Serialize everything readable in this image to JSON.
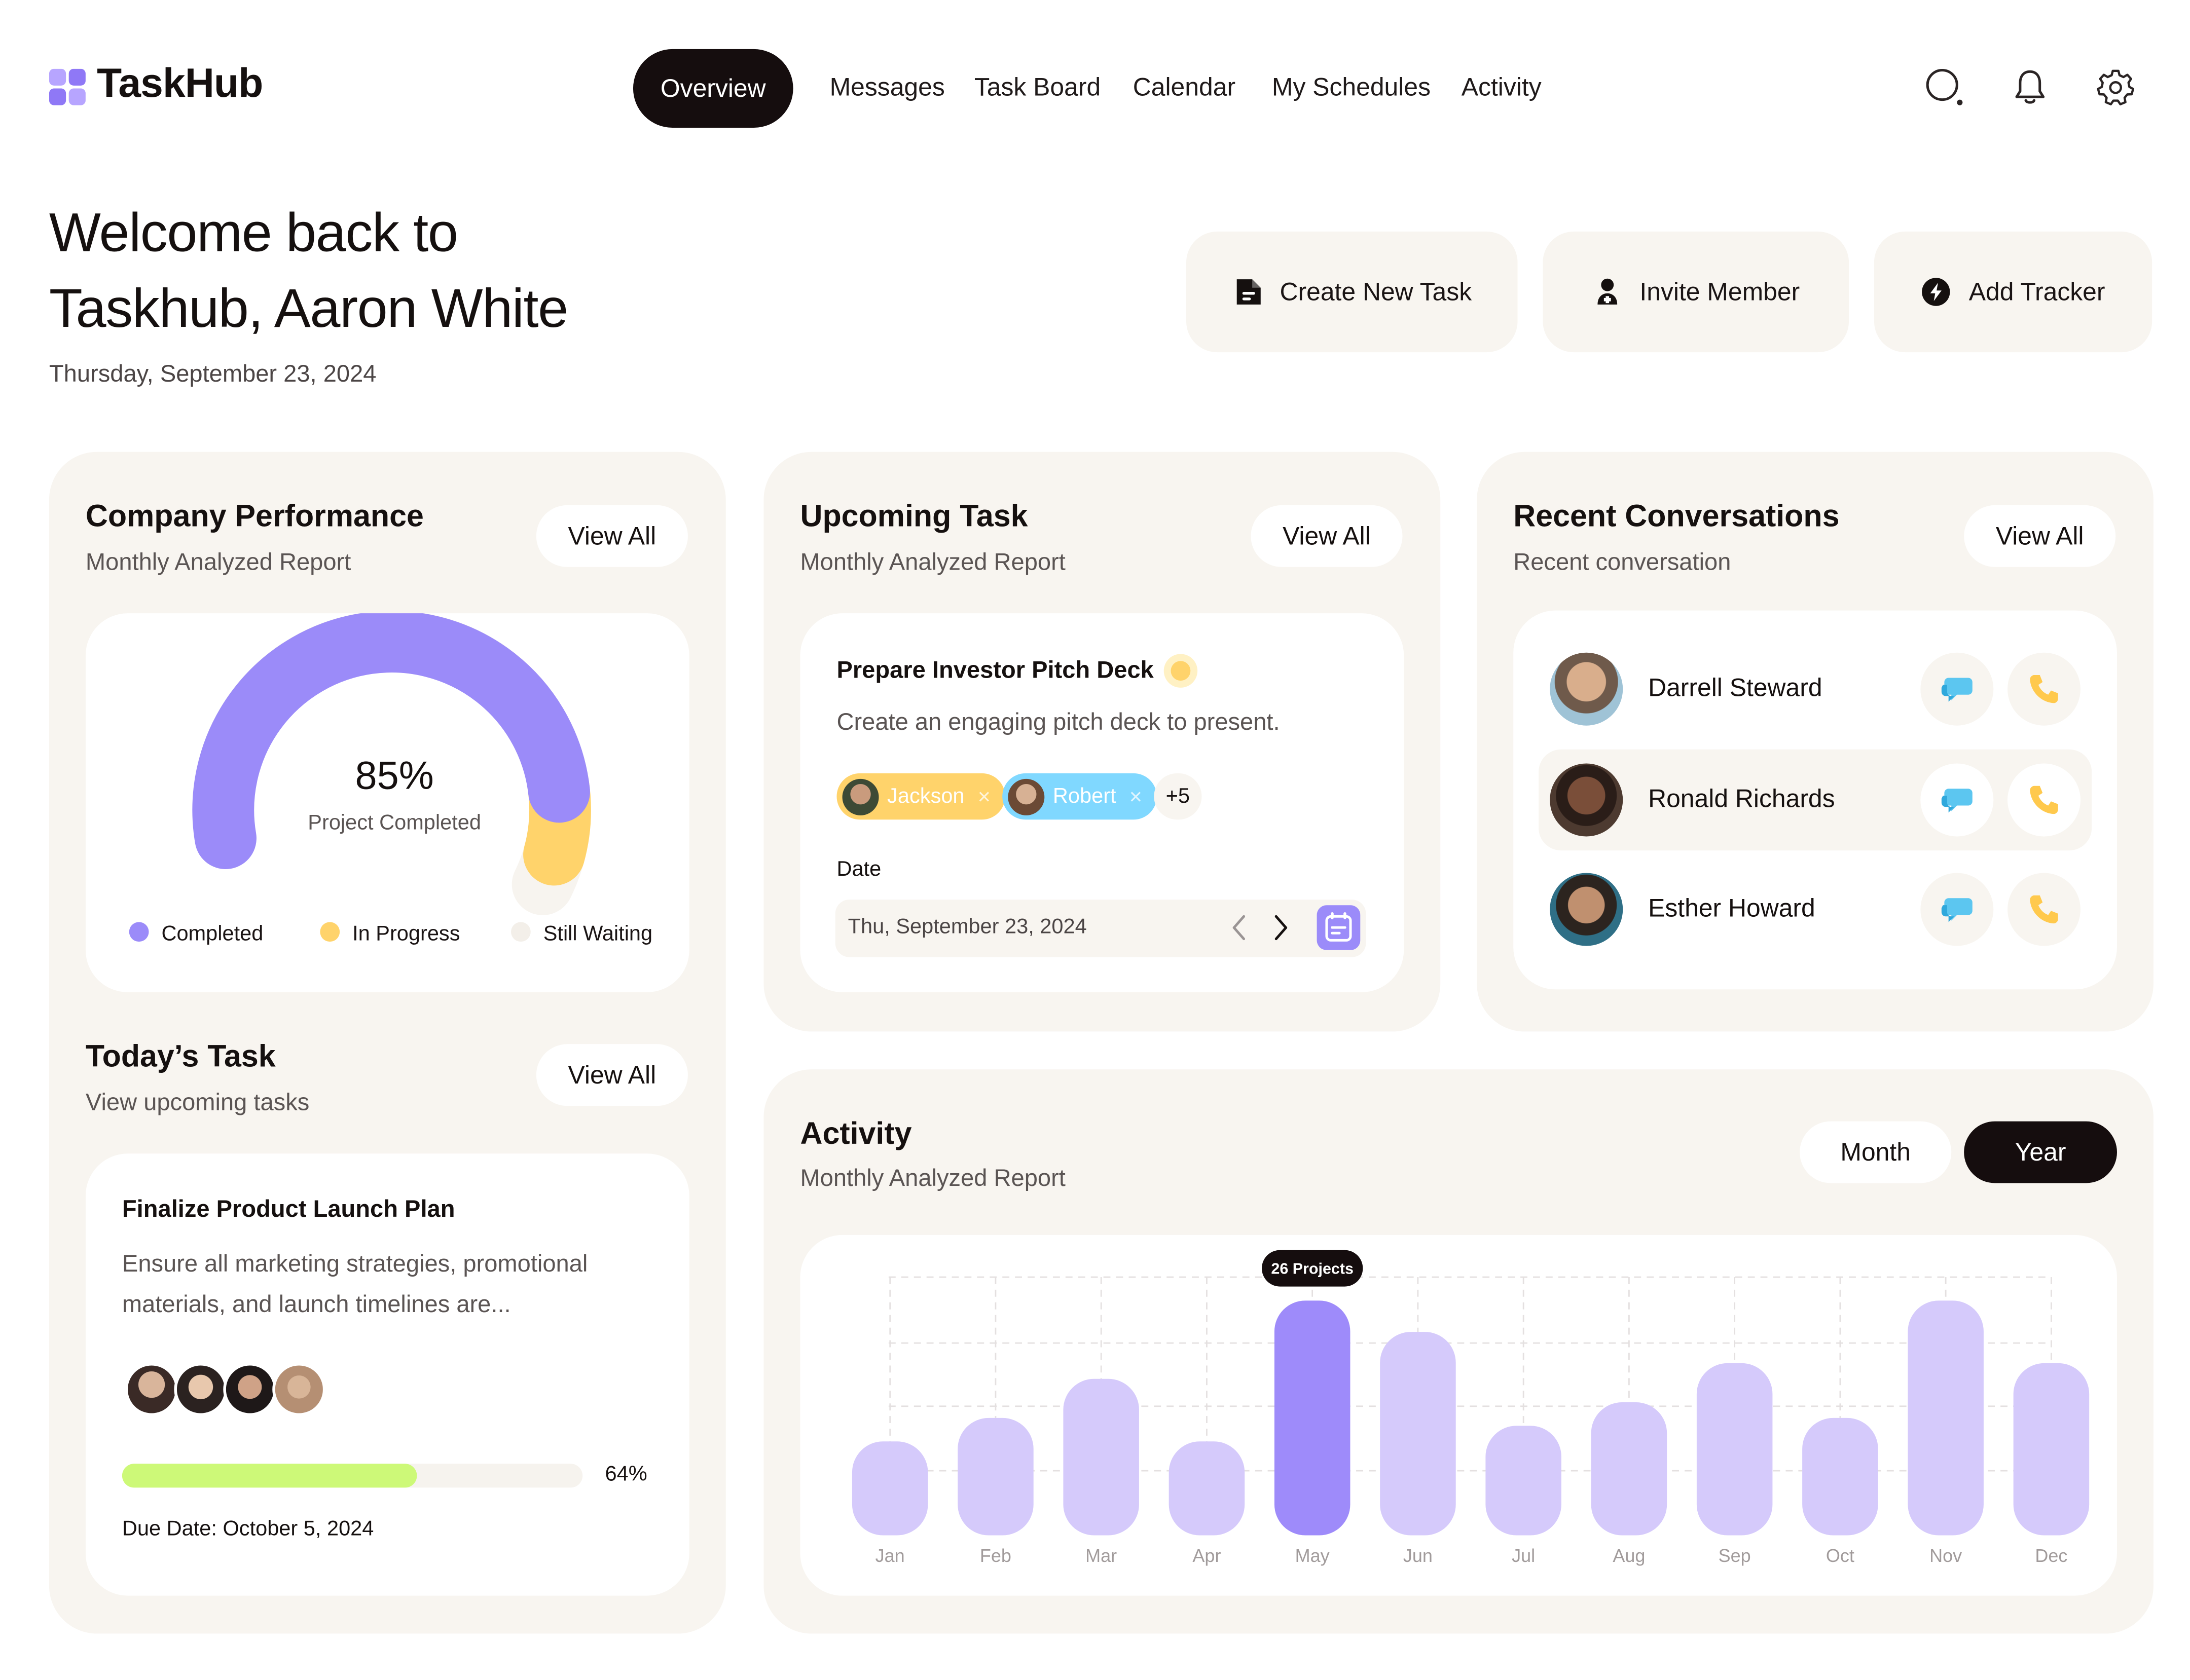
{
  "app": {
    "name": "TaskHub"
  },
  "nav": {
    "items": [
      "Overview",
      "Messages",
      "Task Board",
      "Calendar",
      "My Schedules",
      "Activity"
    ],
    "active": "Overview",
    "icons": [
      "search-icon",
      "bell-icon",
      "gear-icon"
    ]
  },
  "welcome": {
    "line1": "Welcome back to",
    "line2": "Taskhub, Aaron White",
    "date": "Thursday, September 23, 2024"
  },
  "actions": [
    {
      "label": "Create New Task",
      "icon": "document-icon"
    },
    {
      "label": "Invite Member",
      "icon": "add-user-icon"
    },
    {
      "label": "Add Tracker",
      "icon": "bolt-icon"
    }
  ],
  "performance": {
    "title": "Company Performance",
    "subtitle": "Monthly Analyzed Report",
    "view_all": "View All",
    "percent": "85%",
    "percent_label": "Project Completed",
    "completed_fraction": 0.85,
    "in_progress_fraction": 0.1,
    "legend": [
      "Completed",
      "In Progress",
      "Still Waiting"
    ],
    "colors": {
      "completed": "#9b8bf9",
      "in_progress": "#ffd36b",
      "waiting": "#f7f4ef"
    }
  },
  "today_task": {
    "title": "Today’s Task",
    "subtitle": "View upcoming tasks",
    "view_all": "View All",
    "task_title": "Finalize Product Launch Plan",
    "task_desc_1": "Ensure all marketing strategies, promotional",
    "task_desc_2": "materials, and launch timelines are...",
    "progress": "64%",
    "progress_fraction": 0.64,
    "progress_color": "#cdf978",
    "due": "Due Date: October 5, 2024"
  },
  "upcoming": {
    "title": "Upcoming Task",
    "subtitle": "Monthly Analyzed Report",
    "view_all": "View All",
    "task_title": "Prepare Investor Pitch Deck",
    "task_desc": "Create an engaging pitch deck to present.",
    "assignees": [
      "Jackson",
      "Robert"
    ],
    "more": "+5",
    "date_label": "Date",
    "date_value": "Thu, September 23, 2024",
    "colors": {
      "jackson": "#ffd36b",
      "robert": "#80d8ff"
    }
  },
  "conversations": {
    "title": "Recent Conversations",
    "subtitle": "Recent conversation",
    "view_all": "View All",
    "people": [
      "Darrell Steward",
      "Ronald Richards",
      "Esther Howard"
    ],
    "colors": {
      "chat": "#5cc6f0",
      "call": "#ffc94d"
    }
  },
  "activity": {
    "title": "Activity",
    "subtitle": "Monthly Analyzed Report",
    "toggle": [
      "Month",
      "Year"
    ],
    "active_toggle": "Year"
  },
  "chart_data": {
    "type": "bar",
    "categories": [
      "Jan",
      "Feb",
      "Mar",
      "Apr",
      "May",
      "Jun",
      "Jul",
      "Aug",
      "Sep",
      "Oct",
      "Nov",
      "Dec"
    ],
    "values": [
      12,
      15,
      20,
      12,
      30,
      26,
      14,
      17,
      22,
      15,
      30,
      22
    ],
    "highlight_index": 4,
    "tooltip": "26 Projects",
    "ylim": [
      0,
      33
    ],
    "grid": true,
    "colors": {
      "bar": "#d5cafb",
      "highlight": "#9e8bfa"
    }
  }
}
